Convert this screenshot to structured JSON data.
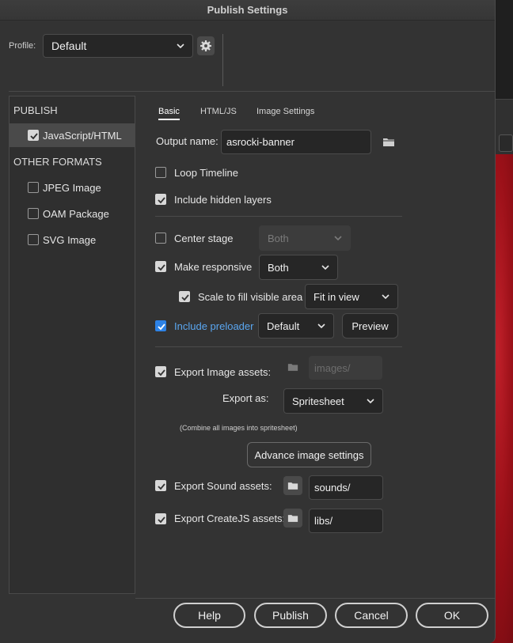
{
  "window": {
    "title": "Publish Settings"
  },
  "profile": {
    "label": "Profile:",
    "value": "Default"
  },
  "sidebar": {
    "publish_header": "PUBLISH",
    "other_header": "OTHER FORMATS",
    "items": [
      {
        "label": "JavaScript/HTML",
        "checked": true
      },
      {
        "label": "JPEG Image",
        "checked": false
      },
      {
        "label": "OAM Package",
        "checked": false
      },
      {
        "label": "SVG Image",
        "checked": false
      }
    ]
  },
  "tabs": [
    {
      "label": "Basic"
    },
    {
      "label": "HTML/JS"
    },
    {
      "label": "Image Settings"
    }
  ],
  "basic": {
    "output_name_label": "Output name:",
    "output_name_value": "asrocki-banner",
    "loop_timeline": "Loop Timeline",
    "include_hidden_layers": "Include hidden layers",
    "center_stage": "Center stage",
    "center_stage_value": "Both",
    "make_responsive": "Make responsive",
    "make_responsive_value": "Both",
    "scale_to_fill": "Scale to fill visible area",
    "scale_to_fill_value": "Fit in view",
    "include_preloader": "Include preloader",
    "preloader_value": "Default",
    "preview_label": "Preview",
    "export_image_assets": "Export Image assets:",
    "image_path": "images/",
    "export_as_label": "Export as:",
    "export_as_value": "Spritesheet",
    "combine_note": "(Combine all images into spritesheet)",
    "advance_image_settings": "Advance image settings",
    "export_sound_assets": "Export Sound assets:",
    "sound_path": "sounds/",
    "export_createjs_assets": "Export CreateJS assets:",
    "libs_path": "libs/"
  },
  "footer": {
    "help": "Help",
    "publish": "Publish",
    "cancel": "Cancel",
    "ok": "OK"
  },
  "colors": {
    "accent_blue": "#2d82e6",
    "dialog_bg": "#333333",
    "canvas_red": "#9a1018"
  },
  "icons": [
    "gear-icon",
    "chevron-down-icon",
    "folder-icon",
    "checkmark-icon"
  ]
}
